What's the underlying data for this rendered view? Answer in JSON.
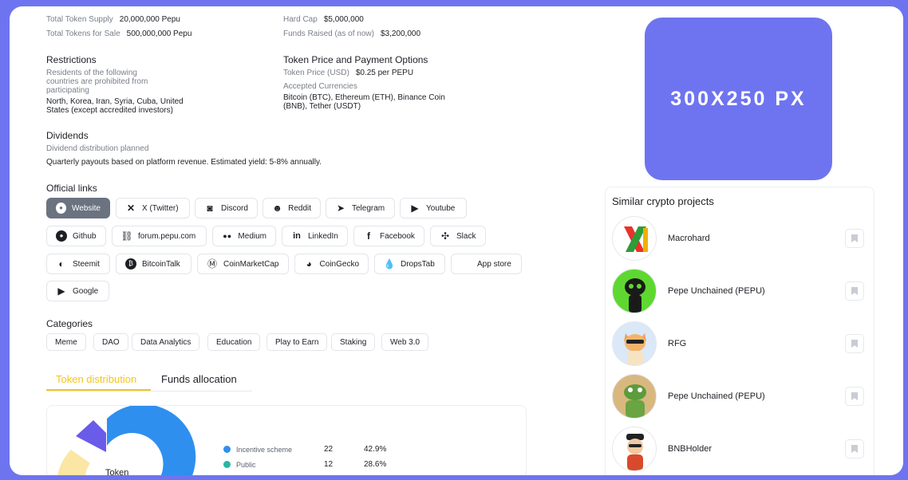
{
  "info_left": {
    "total_supply_label": "Total Token Supply",
    "total_supply_value": "20,000,000 Pepu",
    "for_sale_label": "Total Tokens for Sale",
    "for_sale_value": "500,000,000 Pepu"
  },
  "info_right": {
    "hard_cap_label": "Hard Cap",
    "hard_cap_value": "$5,000,000",
    "funds_label": "Funds Raised (as of now)",
    "funds_value": "$3,200,000"
  },
  "restrictions": {
    "title": "Restrictions",
    "label": "Residents of the following countries are prohibited from participating",
    "value": "North, Korea, Iran, Syria, Cuba, United States (except accredited investors)"
  },
  "price": {
    "title": "Token Price and Payment Options",
    "price_label": "Token Price (USD)",
    "price_value": "$0.25 per PEPU",
    "currencies_label": "Accepted Currencies",
    "currencies_value": "Bitcoin (BTC), Ethereum (ETH), Binance Coin (BNB), Tether (USDT)"
  },
  "dividends": {
    "title": "Dividends",
    "label": "Dividend distribution planned",
    "value": "Quarterly payouts based on platform revenue. Estimated yield: 5-8% annually."
  },
  "links": {
    "title": "Official links",
    "items": [
      {
        "label": "Website",
        "icon": "globe-icon"
      },
      {
        "label": "X (Twitter)",
        "icon": "x-icon"
      },
      {
        "label": "Discord",
        "icon": "discord-icon"
      },
      {
        "label": "Reddit",
        "icon": "reddit-icon"
      },
      {
        "label": "Telegram",
        "icon": "telegram-icon"
      },
      {
        "label": "Youtube",
        "icon": "youtube-icon"
      },
      {
        "label": "Github",
        "icon": "github-icon"
      },
      {
        "label": "forum.pepu.com",
        "icon": "link-icon"
      },
      {
        "label": "Medium",
        "icon": "medium-icon"
      },
      {
        "label": "LinkedIn",
        "icon": "linkedin-icon"
      },
      {
        "label": "Facebook",
        "icon": "facebook-icon"
      },
      {
        "label": "Slack",
        "icon": "slack-icon"
      },
      {
        "label": "Steemit",
        "icon": "steemit-icon"
      },
      {
        "label": "BitcoinTalk",
        "icon": "bitcoin-icon"
      },
      {
        "label": "CoinMarketCap",
        "icon": "coinmarketcap-icon"
      },
      {
        "label": "CoinGecko",
        "icon": "coingecko-icon"
      },
      {
        "label": "DropsTab",
        "icon": "dropstab-icon"
      },
      {
        "label": "App store",
        "icon": "apple-icon"
      },
      {
        "label": "Google",
        "icon": "google-play-icon"
      }
    ]
  },
  "categories": {
    "title": "Categories",
    "items": [
      "Meme",
      "DAO",
      "Data Analytics",
      "Education",
      "Play to Earn",
      "Staking",
      "Web 3.0"
    ]
  },
  "tabs": [
    "Token distribution",
    "Funds allocation"
  ],
  "distribution": {
    "center_label": "Token",
    "legend": [
      {
        "name": "Incentive scheme",
        "count": "22",
        "percent": "42.9%",
        "color": "#2f8fef"
      },
      {
        "name": "Public",
        "count": "12",
        "percent": "28.6%",
        "color": "#26b8a0"
      }
    ]
  },
  "ad": {
    "text": "300X250 PX"
  },
  "similar": {
    "title": "Similar crypto projects",
    "items": [
      {
        "name": "Macrohard",
        "icon": "macrohard-logo"
      },
      {
        "name": "Pepe Unchained (PEPU)",
        "icon": "pepe-avatar"
      },
      {
        "name": "RFG",
        "icon": "cat-avatar"
      },
      {
        "name": "Pepe Unchained (PEPU)",
        "icon": "frog-avatar"
      },
      {
        "name": "BNBHolder",
        "icon": "holder-avatar"
      }
    ]
  },
  "colors": {
    "accent": "#6e74f0",
    "tab_active": "#f5c518"
  }
}
